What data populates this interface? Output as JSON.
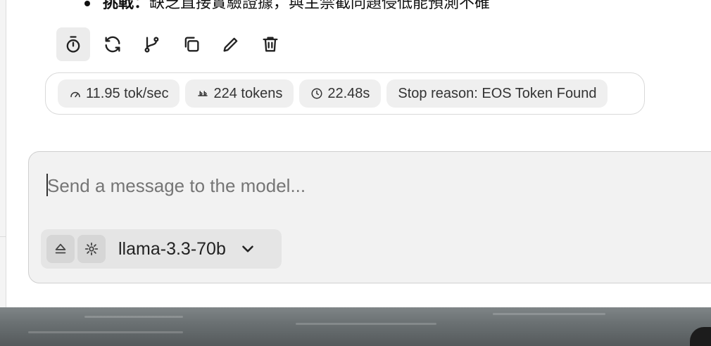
{
  "message": {
    "bullet_bold": "挑戰：",
    "bullet_text": "缺乏直接實驗證據，與主禁截同題侵低能預測不確"
  },
  "actions": [
    {
      "name": "timer-icon"
    },
    {
      "name": "regenerate-icon"
    },
    {
      "name": "branch-icon"
    },
    {
      "name": "copy-icon"
    },
    {
      "name": "edit-icon"
    },
    {
      "name": "delete-icon"
    }
  ],
  "stats": {
    "speed": "11.95 tok/sec",
    "tokens": "224 tokens",
    "time": "22.48s",
    "stop_reason": "Stop reason: EOS Token Found"
  },
  "composer": {
    "placeholder": "Send a message to the model...",
    "value": ""
  },
  "model_bar": {
    "eject_icon": "eject-icon",
    "settings_icon": "gear-icon",
    "model": "llama-3.3-70b"
  }
}
